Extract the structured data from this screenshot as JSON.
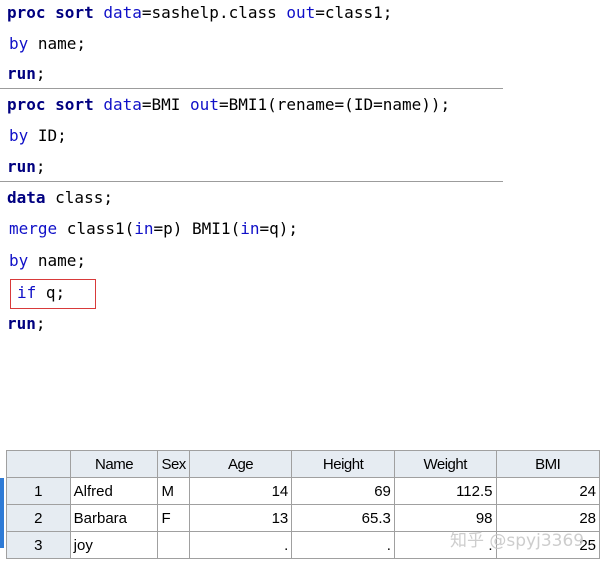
{
  "colors": {
    "keyword": "#000080",
    "option": "#1010c8",
    "highlight_box": "#d83a3a",
    "grid_header_bg": "#e6ecf2",
    "selection_bar": "#2f7bd6"
  },
  "code": {
    "line1": {
      "kw1": "proc",
      "kw2": "sort",
      "opt1": "data",
      "t1": "=sashelp.class ",
      "opt2": "out",
      "t2": "=class1;"
    },
    "line2": {
      "opt1": "by",
      "t1": " name;"
    },
    "line3": {
      "kw1": "run",
      "t1": ";"
    },
    "line4": {
      "kw1": "proc",
      "kw2": "sort",
      "opt1": "data",
      "t1": "=BMI ",
      "opt2": "out",
      "t2": "=BMI1(rename=(ID=name));"
    },
    "line5": {
      "opt1": "by",
      "t1": " ID;"
    },
    "line6": {
      "kw1": "run",
      "t1": ";"
    },
    "line7": {
      "kw1": "data",
      "t1": " class;"
    },
    "line8": {
      "opt1": "merge",
      "t1": " class1(",
      "opt2": "in",
      "t2": "=p) BMI1(",
      "opt3": "in",
      "t3": "=q);"
    },
    "line9": {
      "opt1": "by",
      "t1": " name;"
    },
    "line10": {
      "opt1": "if",
      "t1": " q;"
    },
    "line11": {
      "kw1": "run",
      "t1": ";"
    }
  },
  "grid": {
    "headers": [
      "",
      "Name",
      "Sex",
      "Age",
      "Height",
      "Weight",
      "BMI"
    ],
    "rows": [
      {
        "num": "1",
        "name": "Alfred",
        "sex": "M",
        "age": "14",
        "height": "69",
        "weight": "112.5",
        "bmi": "24"
      },
      {
        "num": "2",
        "name": "Barbara",
        "sex": "F",
        "age": "13",
        "height": "65.3",
        "weight": "98",
        "bmi": "28"
      },
      {
        "num": "3",
        "name": "joy",
        "sex": "",
        "age": ".",
        "height": ".",
        "weight": ".",
        "bmi": "25"
      }
    ]
  },
  "watermark": "知乎 @spyj3369"
}
